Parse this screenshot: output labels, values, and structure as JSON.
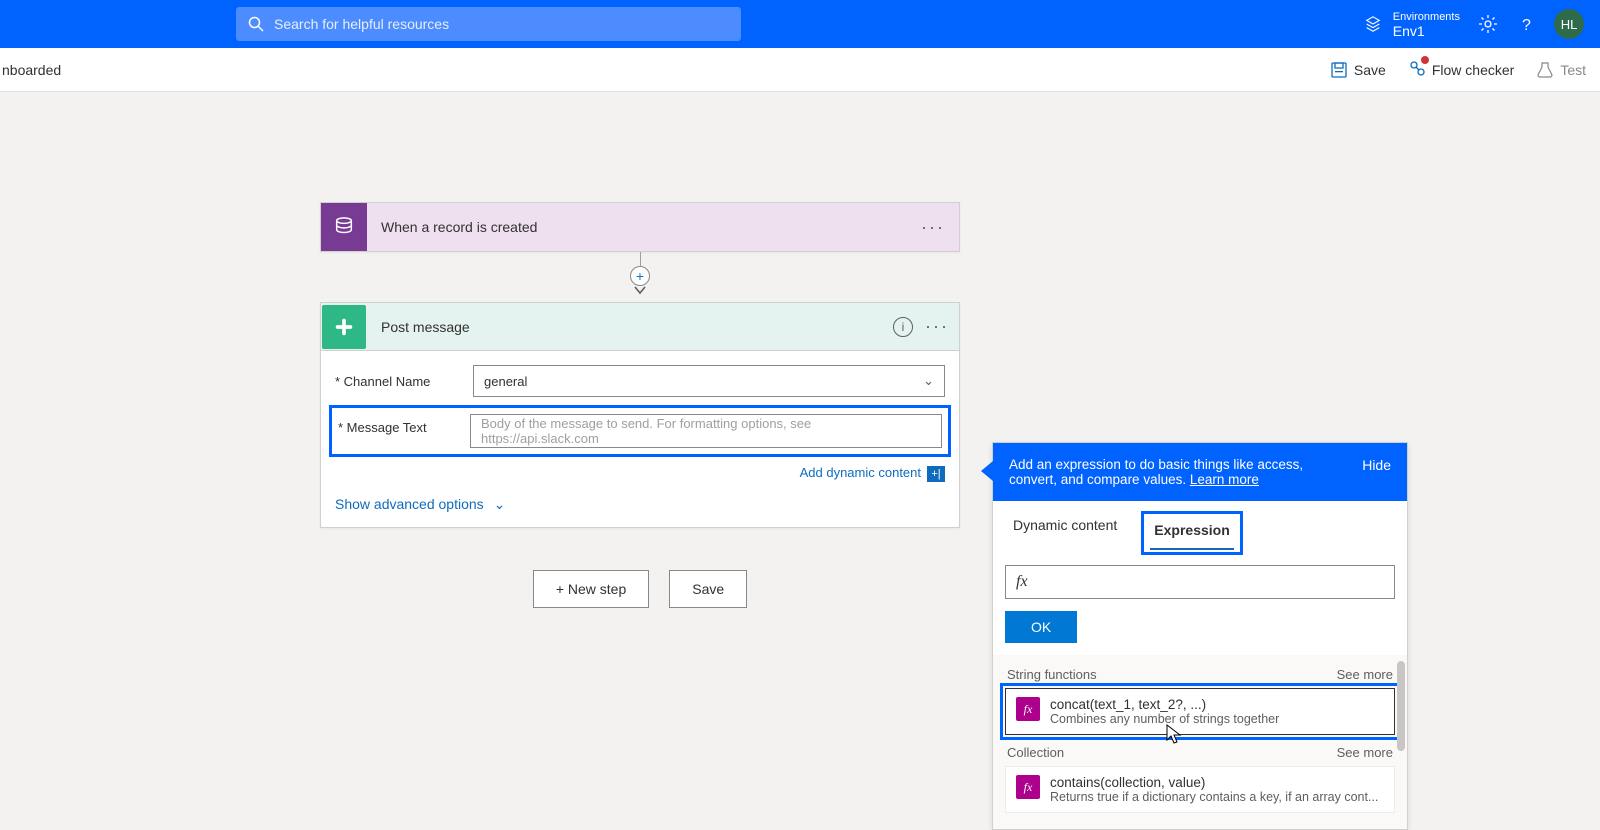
{
  "header": {
    "search_placeholder": "Search for helpful resources",
    "env_label": "Environments",
    "env_name": "Env1",
    "avatar_initials": "HL"
  },
  "toolbar": {
    "left_text": "nboarded",
    "save": "Save",
    "flow_checker": "Flow checker",
    "test": "Test"
  },
  "trigger": {
    "title": "When a record is created"
  },
  "action": {
    "title": "Post message",
    "fields": {
      "channel_label": "* Channel Name",
      "channel_value": "general",
      "message_label": "* Message Text",
      "message_placeholder": "Body of the message to send. For formatting options, see https://api.slack.com"
    },
    "add_dynamic": "Add dynamic content",
    "advanced": "Show advanced options"
  },
  "buttons": {
    "new_step": "+ New step",
    "save": "Save"
  },
  "dyn": {
    "head_text": "Add an expression to do basic things like access, convert, and compare values.",
    "learn_more": "Learn more",
    "hide": "Hide",
    "tab_dynamic": "Dynamic content",
    "tab_expression": "Expression",
    "fx_symbol": "fx",
    "ok": "OK",
    "sections": [
      {
        "title": "String functions",
        "see_more": "See more",
        "items": [
          {
            "name": "concat(text_1, text_2?, ...)",
            "desc": "Combines any number of strings together"
          }
        ],
        "highlighted": true
      },
      {
        "title": "Collection",
        "see_more": "See more",
        "items": [
          {
            "name": "contains(collection, value)",
            "desc": "Returns true if a dictionary contains a key, if an array cont..."
          }
        ],
        "highlighted": false
      }
    ]
  }
}
